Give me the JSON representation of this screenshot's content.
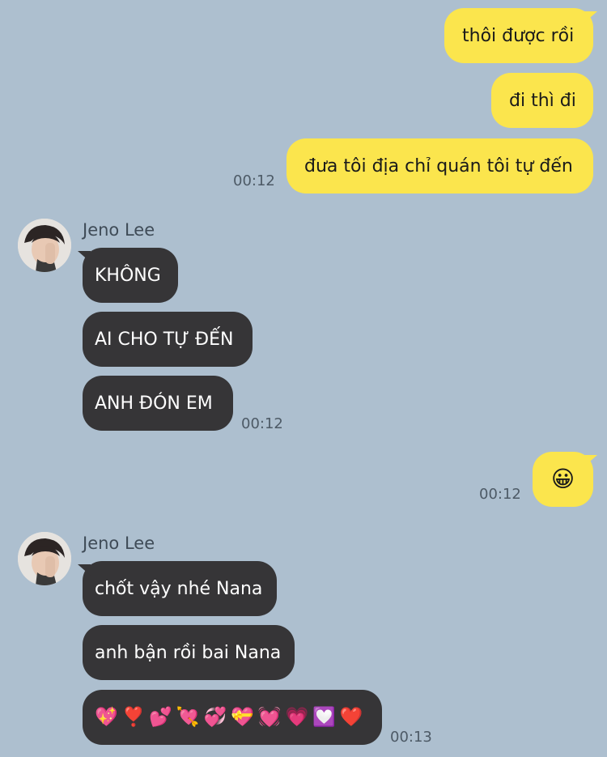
{
  "colors": {
    "background": "#adbfcf",
    "outgoing_bubble": "#fbe54d",
    "incoming_bubble": "#363537",
    "timestamp": "#4d5a66"
  },
  "messages": {
    "out_1": "thôi được rồi",
    "out_2": "đi thì đi",
    "out_3": "đưa tôi địa chỉ quán tôi tự đến",
    "out_group_1_time": "00:12",
    "group_1": {
      "sender": "Jeno Lee",
      "msg_1": "KHÔNG",
      "msg_2": "AI CHO TỰ ĐẾN",
      "msg_3": "ANH ĐÓN EM",
      "time": "00:12"
    },
    "out_4": "😀",
    "out_4_time": "00:12",
    "group_2": {
      "sender": "Jeno Lee",
      "msg_1": "chốt vậy nhé Nana",
      "msg_2": "anh bận rồi bai Nana",
      "emojis": [
        "💖",
        "❣️",
        "💕",
        "💘",
        "💞",
        "💝",
        "💓",
        "💗",
        "💟",
        "❤️"
      ],
      "time": "00:13"
    }
  }
}
